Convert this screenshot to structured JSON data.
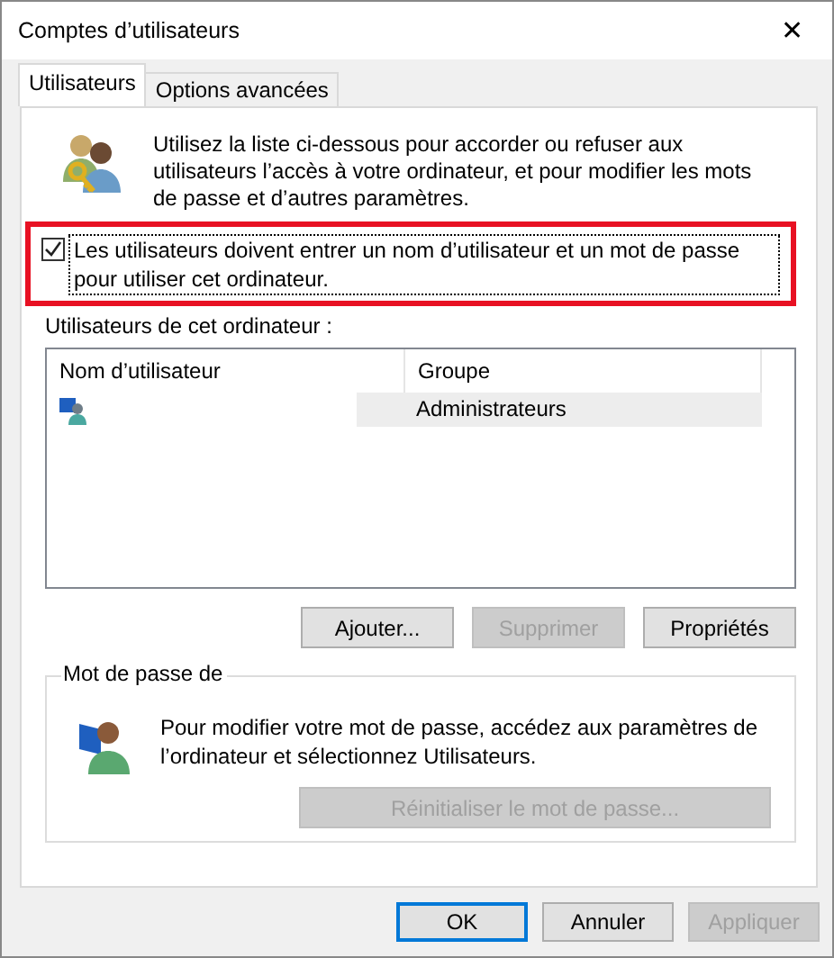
{
  "window": {
    "title": "Comptes d’utilisateurs",
    "close": "✕"
  },
  "tabs": [
    {
      "label": "Utilisateurs",
      "selected": true
    },
    {
      "label": "Options avancées",
      "selected": false
    }
  ],
  "intro": "Utilisez la liste ci-dessous pour accorder ou refuser aux utilisateurs l’accès à votre ordinateur, et pour modifier les mots de passe et d’autres paramètres.",
  "require_login": {
    "label": "Les utilisateurs doivent entrer un nom d’utilisateur et un mot de passe pour utiliser cet ordinateur.",
    "checked": true,
    "highlighted": true
  },
  "users_label": "Utilisateurs de cet ordinateur :",
  "table": {
    "columns": [
      "Nom d’utilisateur",
      "Groupe"
    ],
    "rows": [
      {
        "group": "Administrateurs",
        "selected": true
      }
    ]
  },
  "user_buttons": [
    {
      "label": "Ajouter...",
      "disabled": false
    },
    {
      "label": "Supprimer",
      "disabled": true
    },
    {
      "label": "Propriétés",
      "disabled": false
    }
  ],
  "password_group": {
    "title": "Mot de passe de",
    "text": "Pour modifier votre mot de passe, accédez aux paramètres de l’ordinateur et sélectionnez Utilisateurs.",
    "button": {
      "label": "Réinitialiser le mot de passe...",
      "disabled": true
    }
  },
  "dialog_buttons": [
    {
      "label": "OK",
      "disabled": false,
      "default": true
    },
    {
      "label": "Annuler",
      "disabled": false,
      "default": false
    },
    {
      "label": "Appliquer",
      "disabled": true,
      "default": false
    }
  ]
}
